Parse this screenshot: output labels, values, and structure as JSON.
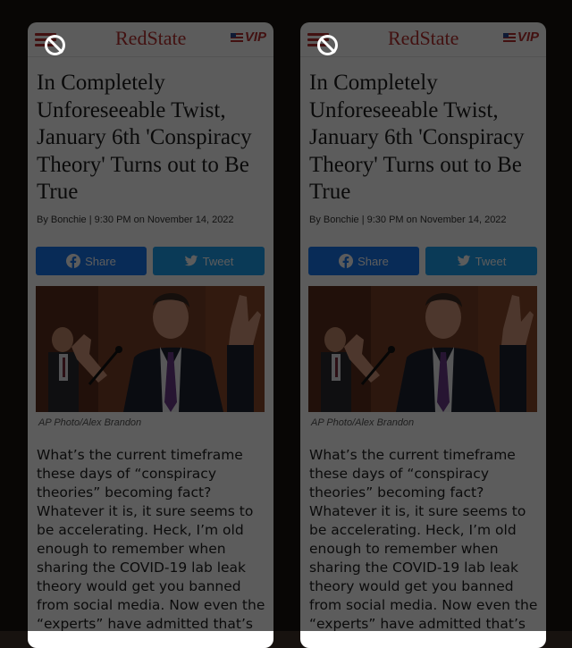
{
  "screens": [
    {
      "logo": "RedState",
      "vip_label": "VIP",
      "title": "In Completely Unforeseeable Twist, January 6th 'Conspiracy Theory' Turns out to Be True",
      "byline": "By Bonchie | 9:30 PM on November 14, 2022",
      "share_label": "Share",
      "tweet_label": "Tweet",
      "photo_caption": "AP Photo/Alex Brandon",
      "body": "What’s the current timeframe these days of “conspiracy theories” becoming fact? Whatever it is, it sure seems to be accelerating. Heck, I’m old enough to remember when sharing the COVID-19 lab leak theory would get you banned from social media. Now even the “experts” have admitted that’s"
    },
    {
      "logo": "RedState",
      "vip_label": "VIP",
      "title": "In Completely Unforeseeable Twist, January 6th 'Conspiracy Theory' Turns out to Be True",
      "byline": "By Bonchie | 9:30 PM on November 14, 2022",
      "share_label": "Share",
      "tweet_label": "Tweet",
      "photo_caption": "AP Photo/Alex Brandon",
      "body": "What’s the current timeframe these days of “conspiracy theories” becoming fact? Whatever it is, it sure seems to be accelerating. Heck, I’m old enough to remember when sharing the COVID-19 lab leak theory would get you banned from social media. Now even the “experts” have admitted that’s"
    }
  ],
  "icons": {
    "menu": "hamburger-menu-icon",
    "flag": "us-flag-icon",
    "facebook": "facebook-icon",
    "twitter": "twitter-icon",
    "overlay": "no-entry-icon"
  },
  "colors": {
    "brand_red": "#b8312f",
    "facebook_blue": "#1877f2",
    "twitter_blue": "#1da1f2",
    "backdrop": "#17120f"
  }
}
